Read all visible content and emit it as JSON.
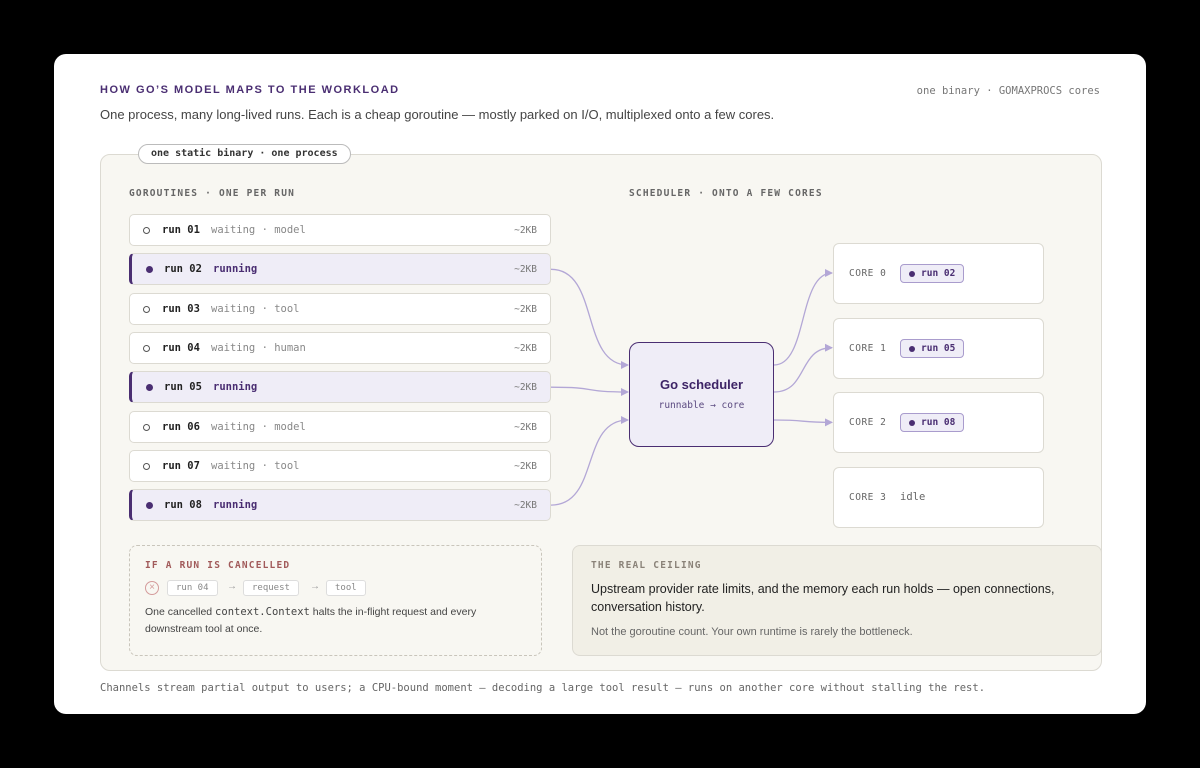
{
  "header": {
    "title": "HOW GO’S MODEL MAPS TO THE WORKLOAD",
    "top_right": "one binary · GOMAXPROCS cores",
    "subtitle": "One process, many long-lived runs. Each is a cheap goroutine — mostly parked on I/O, multiplexed onto a few cores."
  },
  "panel": {
    "label": "one static binary · one process",
    "goroutines_heading": "GOROUTINES · ONE PER RUN",
    "scheduler_heading": "SCHEDULER · ONTO A FEW CORES"
  },
  "runs": [
    {
      "name": "run 01",
      "status": "waiting · model",
      "size": "~2KB",
      "running": false
    },
    {
      "name": "run 02",
      "status": "running",
      "size": "~2KB",
      "running": true
    },
    {
      "name": "run 03",
      "status": "waiting · tool",
      "size": "~2KB",
      "running": false
    },
    {
      "name": "run 04",
      "status": "waiting · human",
      "size": "~2KB",
      "running": false
    },
    {
      "name": "run 05",
      "status": "running",
      "size": "~2KB",
      "running": true
    },
    {
      "name": "run 06",
      "status": "waiting · model",
      "size": "~2KB",
      "running": false
    },
    {
      "name": "run 07",
      "status": "waiting · tool",
      "size": "~2KB",
      "running": false
    },
    {
      "name": "run 08",
      "status": "running",
      "size": "~2KB",
      "running": true
    }
  ],
  "scheduler": {
    "title": "Go scheduler",
    "subtitle": "runnable → core"
  },
  "cores": [
    {
      "label": "CORE 0",
      "run": "run 02",
      "idle": ""
    },
    {
      "label": "CORE 1",
      "run": "run 05",
      "idle": ""
    },
    {
      "label": "CORE 2",
      "run": "run 08",
      "idle": ""
    },
    {
      "label": "CORE 3",
      "run": "",
      "idle": "idle"
    }
  ],
  "cancel": {
    "heading": "IF A RUN IS CANCELLED",
    "chips": [
      "run 04",
      "request",
      "tool"
    ],
    "text_before": "One cancelled ",
    "text_code": "context.Context",
    "text_after": " halts the in-flight request and every downstream tool at once."
  },
  "ceiling": {
    "heading": "THE REAL CEILING",
    "main": "Upstream provider rate limits, and the memory each run holds — open connections, conversation history.",
    "note": "Not the goroutine count. Your own runtime is rarely the bottleneck."
  },
  "footer": "Channels stream partial output to users; a CPU-bound moment — decoding a large tool result — runs on another core without stalling the rest.",
  "colors": {
    "accent": "#4a2e72",
    "accent_light": "#efedf7",
    "wire": "#b3a7d6",
    "panel_bg": "#f8f7f2"
  }
}
